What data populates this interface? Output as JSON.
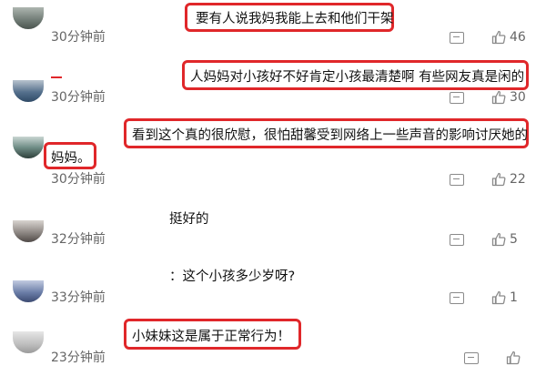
{
  "comments": [
    {
      "time": "30分钟前",
      "text": "要有人说我妈我能上去和他们干架",
      "likes": "46"
    },
    {
      "time": "30分钟前",
      "text": "人妈妈对小孩好不好肯定小孩最清楚啊 有些网友真是闲的",
      "likes": "30"
    },
    {
      "time": "30分钟前",
      "text_line1": "看到这个真的很欣慰，很怕甜馨受到网络上一些声音的影响讨厌她的",
      "text_line2": "妈妈。",
      "likes": "22"
    },
    {
      "time": "32分钟前",
      "text": "挺好的",
      "likes": "5"
    },
    {
      "time": "33分钟前",
      "text": "：这个小孩多少岁呀?",
      "likes": "1"
    },
    {
      "time": "23分钟前",
      "text": "小妹妹这是属于正常行为！",
      "likes": ""
    }
  ],
  "icons": {
    "reply": "reply-icon",
    "like": "thumbs-up-icon"
  },
  "colors": {
    "highlight": "#e0272a",
    "meta": "#666666",
    "icon": "#8a8a8a"
  }
}
